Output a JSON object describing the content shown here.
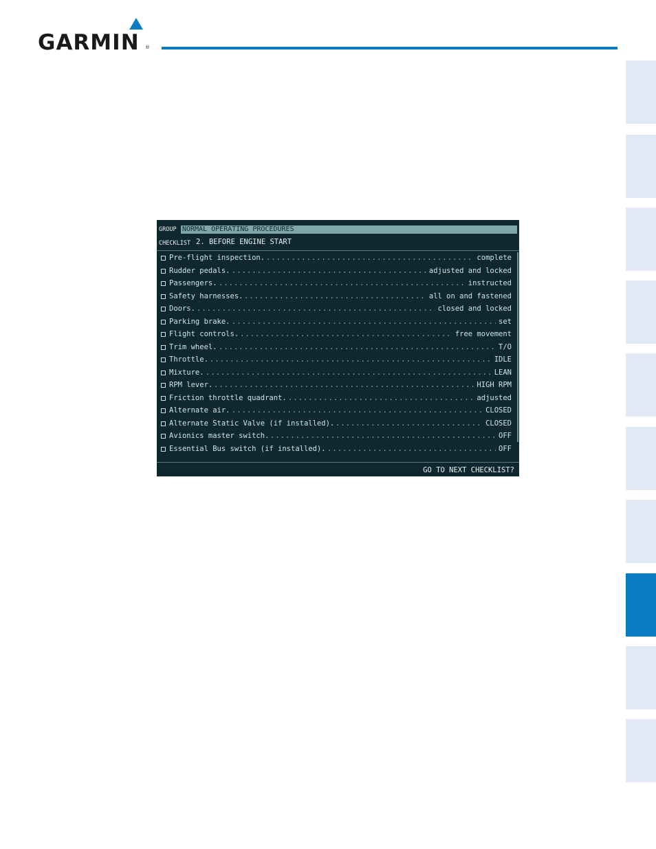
{
  "brand": {
    "name": "GARMIN",
    "registered": "®",
    "accent_color": "#0a7cc1"
  },
  "side_tabs": {
    "count": 10,
    "active_index": 7,
    "active_color": "#0b7cc4",
    "inactive_color": "#e2e8f6"
  },
  "screen": {
    "group_label": "GROUP",
    "group_value": "NORMAL OPERATING PROCEDURES",
    "checklist_label": "CHECKLIST",
    "checklist_value": "2. BEFORE ENGINE START",
    "items": [
      {
        "name": "Pre-flight inspection.",
        "value": "complete"
      },
      {
        "name": "Rudder pedals.",
        "value": "adjusted and locked"
      },
      {
        "name": "Passengers.",
        "value": "instructed"
      },
      {
        "name": "Safety harnesses.",
        "value": "all on and fastened"
      },
      {
        "name": "Doors.",
        "value": "closed and locked"
      },
      {
        "name": "Parking brake.",
        "value": "set"
      },
      {
        "name": "Flight controls.",
        "value": "free movement"
      },
      {
        "name": "Trim wheel.",
        "value": "T/O"
      },
      {
        "name": "Throttle.",
        "value": "IDLE"
      },
      {
        "name": "Mixture.",
        "value": "LEAN"
      },
      {
        "name": "RPM lever.",
        "value": "HIGH RPM"
      },
      {
        "name": "Friction throttle quadrant.",
        "value": "adjusted"
      },
      {
        "name": "Alternate air.",
        "value": "CLOSED"
      },
      {
        "name": "Alternate Static Valve (if installed).",
        "value": "CLOSED"
      },
      {
        "name": "Avionics master switch.",
        "value": "OFF"
      },
      {
        "name": "Essential Bus switch (if installed).",
        "value": "OFF"
      }
    ],
    "footer_prompt": "GO TO NEXT CHECKLIST?"
  }
}
